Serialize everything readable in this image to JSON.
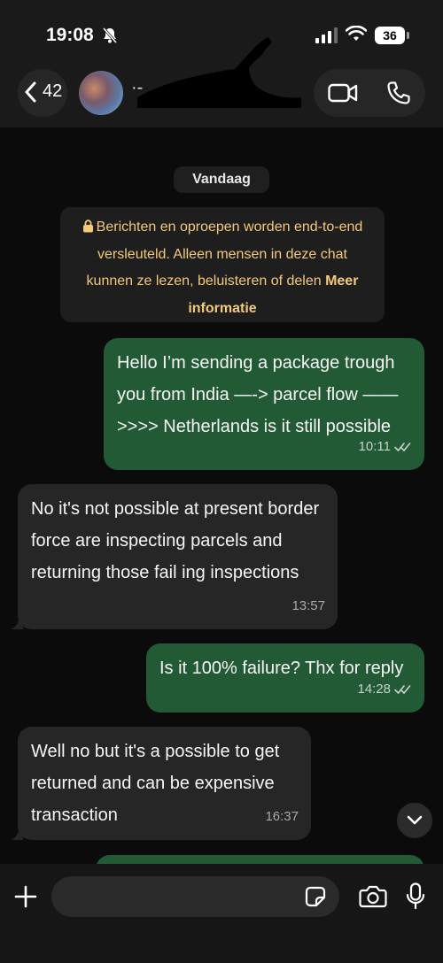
{
  "status_bar": {
    "time": "19:08",
    "battery": "36"
  },
  "header": {
    "back_count": "42",
    "contact_name": "·-"
  },
  "date_chip": "Vandaag",
  "encryption_notice": {
    "text": "Berichten en oproepen worden end-to-end versleuteld. Alleen mensen in deze chat kunnen ze lezen, beluisteren of delen",
    "link": "Meer informatie"
  },
  "messages": [
    {
      "direction": "outgoing",
      "text": "Hello I’m sending a package trough you from India —-> parcel flow —— >>>> Netherlands is it still possible",
      "time": "10:11",
      "status": "read"
    },
    {
      "direction": "incoming",
      "text": "No it's not possible at present border force are inspecting parcels and returning those fail ing inspections",
      "time": "13:57"
    },
    {
      "direction": "outgoing",
      "text": "Is it 100% failure? Thx for reply",
      "time": "14:28",
      "status": "read"
    },
    {
      "direction": "incoming",
      "text": "Well no but it's a possible to get returned and can be expensive transaction",
      "time": "16:37"
    }
  ],
  "composer": {
    "placeholder": ""
  },
  "icons": {
    "back": "chevron-left-icon",
    "video": "video-call-icon",
    "phone": "phone-icon",
    "lock": "lock-icon",
    "read": "double-check-icon",
    "scroll": "chevron-down-icon",
    "plus": "plus-icon",
    "sticker": "sticker-icon",
    "camera": "camera-icon",
    "mic": "microphone-icon",
    "mute": "bell-slash-icon",
    "signal": "signal-icon",
    "wifi": "wifi-icon"
  },
  "colors": {
    "outgoing_bubble": "#225a35",
    "incoming_bubble": "#262626",
    "notice_text": "#f3c97a",
    "background": "#0b0b0b"
  }
}
